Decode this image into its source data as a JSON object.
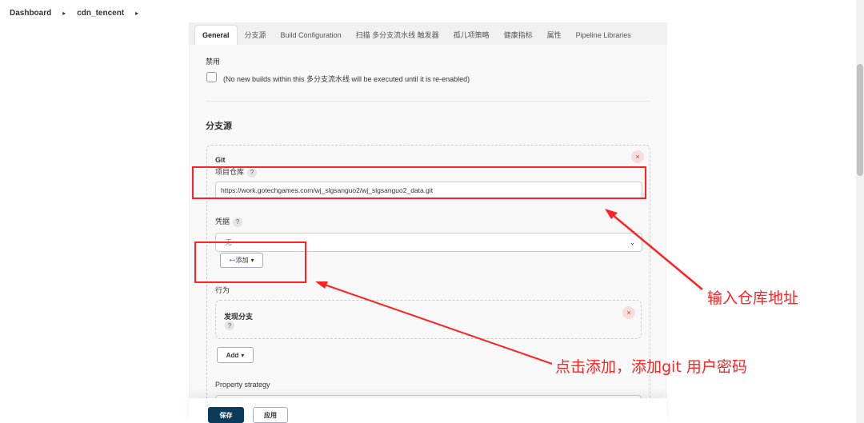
{
  "breadcrumb": [
    "Dashboard",
    "cdn_tencent"
  ],
  "tabs": [
    "General",
    "分支源",
    "Build Configuration",
    "扫描 多分支流水线 触发器",
    "孤儿项策略",
    "健康指标",
    "属性",
    "Pipeline Libraries"
  ],
  "disable": {
    "label": "禁用",
    "checkbox_text": "(No new builds within this 多分支流水线 will be executed until it is re-enabled)"
  },
  "branch_sources": {
    "title": "分支源",
    "git": {
      "title": "Git",
      "repo_label": "项目仓库",
      "repo_value": "https://work.gotechgames.com/wj_slgsanguo2/wj_slgsanguo2_data.git",
      "cred_label": "凭据",
      "cred_value": "- 无 -",
      "add_cred": "添加",
      "behavior_label": "行为",
      "discover": "发现分支",
      "add": "Add",
      "property_strategy": "Property strategy"
    }
  },
  "help": "?",
  "close": "×",
  "footer": {
    "save": "保存",
    "apply": "应用"
  },
  "annotations": {
    "repo": "输入仓库地址",
    "add": "点击添加，添加git 用户密码"
  },
  "colors": {
    "annotation": "#ff2222",
    "save": "#0b3a5b"
  }
}
